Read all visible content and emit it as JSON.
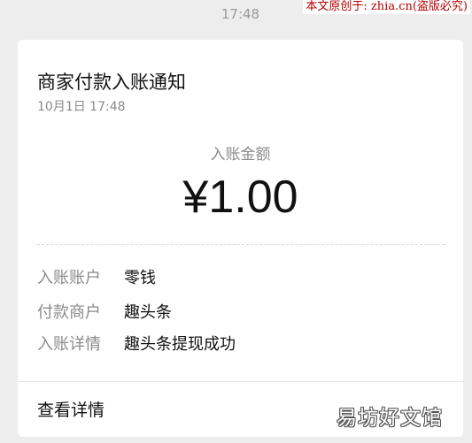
{
  "status": {
    "time": "17:48"
  },
  "watermark": {
    "top_text": "本文原创于: zhia.cn(盗版必究)",
    "bottom_text": "易坊好文馆"
  },
  "notification": {
    "title": "商家付款入账通知",
    "datetime": "10月1日  17:48",
    "amount_label": "入账金额",
    "amount": "¥1.00",
    "rows": [
      {
        "label": "入账账户",
        "value": "零钱"
      },
      {
        "label": "付款商户",
        "value": "趣头条"
      },
      {
        "label": "入账详情",
        "value": "趣头条提现成功"
      }
    ],
    "details_link": "查看详情"
  }
}
